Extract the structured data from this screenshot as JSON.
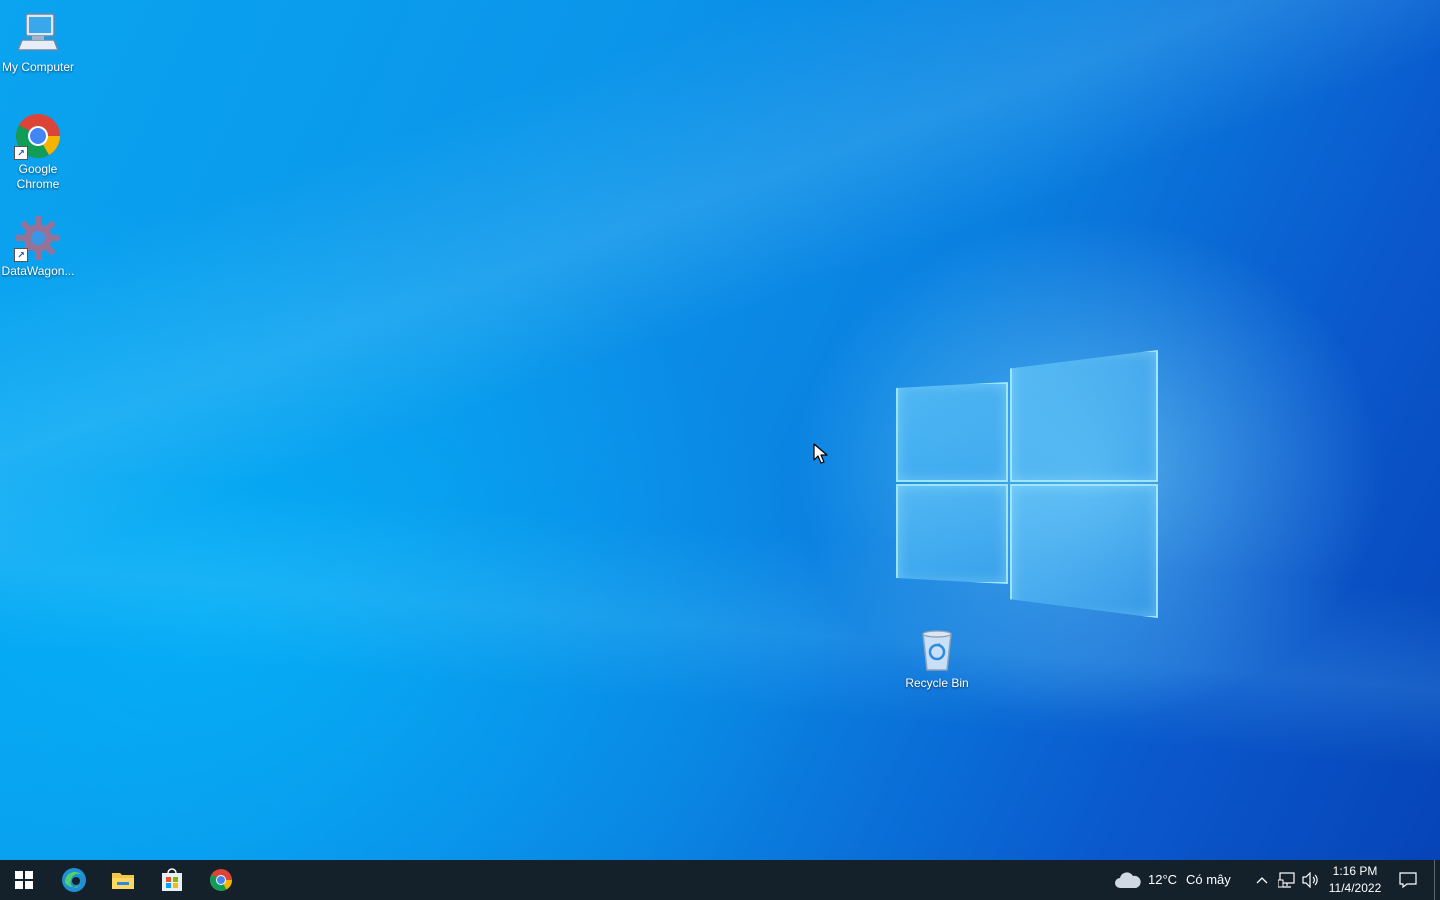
{
  "desktop": {
    "icons": [
      {
        "label": "My Computer"
      },
      {
        "label": "Google Chrome"
      },
      {
        "label": "DataWagon..."
      },
      {
        "label": "Recycle Bin"
      }
    ]
  },
  "taskbar": {
    "pinned": [
      "start-icon",
      "edge-icon",
      "file-explorer-icon",
      "store-icon",
      "chrome-icon"
    ],
    "weather": {
      "temperature": "12°C",
      "condition": "Có mây"
    },
    "clock": {
      "time": "1:16 PM",
      "date": "11/4/2022"
    }
  },
  "colors": {
    "taskbar": "#14202a",
    "desktop_accent": "#0a7fe0"
  }
}
